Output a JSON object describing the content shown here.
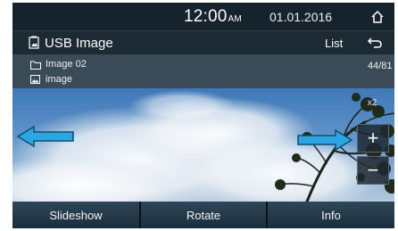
{
  "statusbar": {
    "time": "12:00",
    "ampm": "AM",
    "date": "01.01.2016"
  },
  "titlebar": {
    "title": "USB Image",
    "list_label": "List"
  },
  "infobar": {
    "folder_name": "Image 02",
    "file_name": "image",
    "counter": "44/81"
  },
  "zoom": {
    "level_label": "x2",
    "plus": "+",
    "minus": "−"
  },
  "toolbar": {
    "slideshow": "Slideshow",
    "rotate": "Rotate",
    "info": "Info"
  },
  "colors": {
    "accent_arrow": "#2aa6e0",
    "bar_dark": "#16232d"
  }
}
